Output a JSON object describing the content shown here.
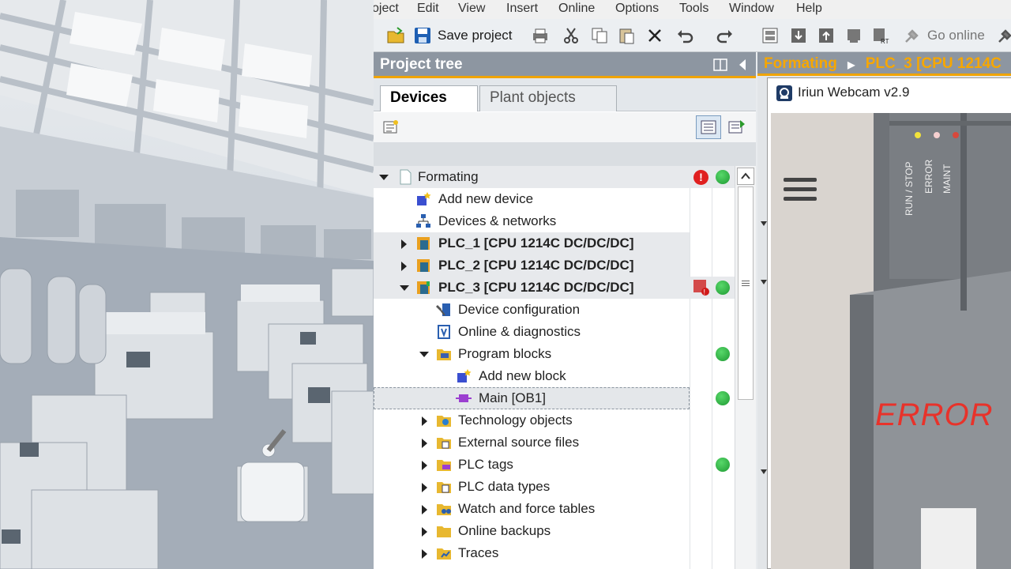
{
  "menu": {
    "items": [
      "oject",
      "Edit",
      "View",
      "Insert",
      "Online",
      "Options",
      "Tools",
      "Window",
      "Help"
    ]
  },
  "toolbar": {
    "save_label": "Save project",
    "go_online_label": "Go online"
  },
  "project_tree": {
    "title": "Project tree",
    "tabs": [
      {
        "label": "Devices",
        "active": true
      },
      {
        "label": "Plant objects",
        "active": false
      }
    ],
    "rows": [
      {
        "label": "Formating",
        "expanded": true
      },
      {
        "label": "Add new device"
      },
      {
        "label": "Devices & networks"
      },
      {
        "label": "PLC_1 [CPU 1214C DC/DC/DC]"
      },
      {
        "label": "PLC_2 [CPU 1214C DC/DC/DC]"
      },
      {
        "label": "PLC_3 [CPU 1214C DC/DC/DC]"
      },
      {
        "label": "Device configuration"
      },
      {
        "label": "Online & diagnostics"
      },
      {
        "label": "Program blocks"
      },
      {
        "label": "Add new block"
      },
      {
        "label": "Main [OB1]"
      },
      {
        "label": "Technology objects"
      },
      {
        "label": "External source files"
      },
      {
        "label": "PLC tags"
      },
      {
        "label": "PLC data types"
      },
      {
        "label": "Watch and force tables"
      },
      {
        "label": "Online backups"
      },
      {
        "label": "Traces"
      }
    ]
  },
  "editor": {
    "breadcrumb_project": "Formating",
    "breadcrumb_device": "PLC_3 [CPU 1214C"
  },
  "webcam": {
    "title": "Iriun Webcam v2.9",
    "plc_leds": [
      "RUN / STOP",
      "ERROR",
      "MAINT"
    ],
    "overlay_text": "ERROR"
  },
  "colors": {
    "accent": "#f0a400",
    "status_ok": "#1e9a32",
    "status_error": "#e02020",
    "overlay_error": "#e8322a"
  }
}
